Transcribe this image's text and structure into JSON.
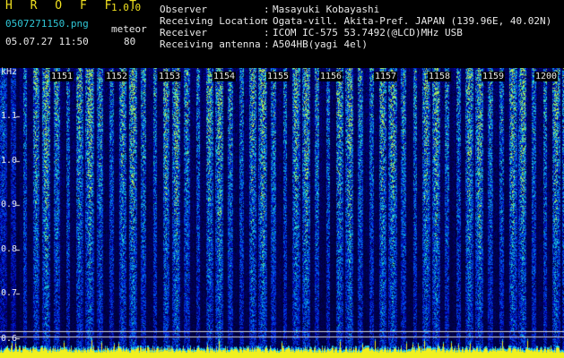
{
  "header": {
    "app_title": "H R O F F T",
    "app_version": "1.0.0",
    "file_name": "0507271150.png",
    "mode_label": "meteor",
    "timestamp": "05.07.27 11:50",
    "mode_value": "80"
  },
  "info": {
    "labels": [
      "Observer",
      "Receiving Location",
      "Receiver",
      "Receiving antenna"
    ],
    "values": [
      "Masayuki Kobayashi",
      "Ogata-vill. Akita-Pref. JAPAN (139.96E, 40.02N)",
      "ICOM IC-575 53.7492(@LCD)MHz USB",
      "A504HB(yagi 4el)"
    ]
  },
  "axis": {
    "y_unit": "kHz",
    "y_ticks": [
      "1.1",
      "1.0",
      "0.9",
      "0.8",
      "0.7",
      "0.6"
    ],
    "x_ticks": [
      "1151",
      "1152",
      "1153",
      "1154",
      "1155",
      "1156",
      "1157",
      "1158",
      "1159",
      "1200"
    ]
  },
  "colors": {
    "background": "#000000",
    "text": "#e8e8e8",
    "title": "#f0e020",
    "signal_low": "#0a2a9a",
    "signal_high": "#20d0c0",
    "baseline": "#f0f020"
  }
}
